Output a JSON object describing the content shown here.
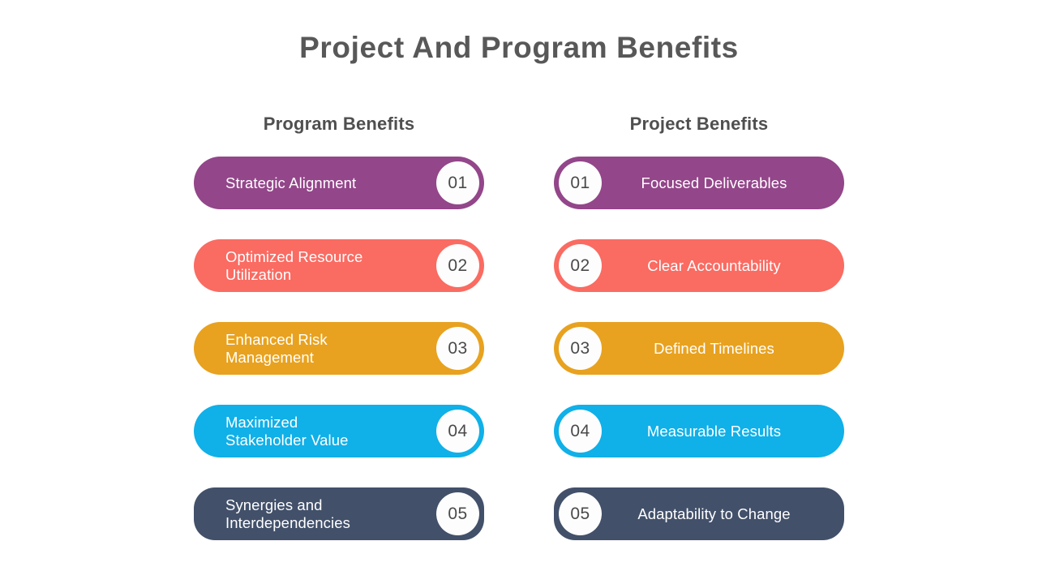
{
  "slide": {
    "title": "Project And Program Benefits",
    "background_color": "#ffffff",
    "title_color": "#585858"
  },
  "columns": [
    {
      "heading": "Program Benefits",
      "side": "left",
      "items": [
        {
          "number": "01",
          "label": "Strategic Alignment",
          "color": "#93468a"
        },
        {
          "number": "02",
          "label": "Optimized Resource\nUtilization",
          "color": "#fa6b62"
        },
        {
          "number": "03",
          "label": "Enhanced Risk\nManagement",
          "color": "#e8a21f"
        },
        {
          "number": "04",
          "label": "Maximized\nStakeholder Value",
          "color": "#10b0e8"
        },
        {
          "number": "05",
          "label": "Synergies and\nInterdependencies",
          "color": "#42506a"
        }
      ]
    },
    {
      "heading": "Project Benefits",
      "side": "right",
      "items": [
        {
          "number": "01",
          "label": "Focused Deliverables",
          "color": "#93468a"
        },
        {
          "number": "02",
          "label": "Clear Accountability",
          "color": "#fa6b62"
        },
        {
          "number": "03",
          "label": "Defined Timelines",
          "color": "#e8a21f"
        },
        {
          "number": "04",
          "label": "Measurable Results",
          "color": "#10b0e8"
        },
        {
          "number": "05",
          "label": "Adaptability to Change",
          "color": "#42506a"
        }
      ]
    }
  ]
}
